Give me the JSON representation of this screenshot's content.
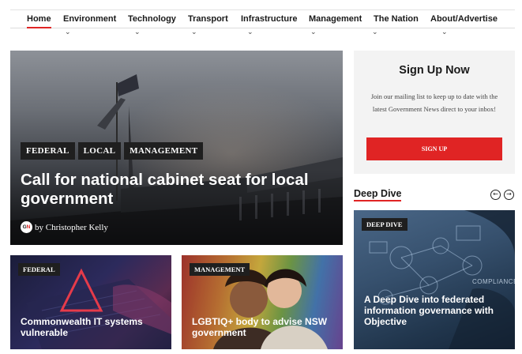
{
  "nav": {
    "items": [
      {
        "label": "Home",
        "active": true
      },
      {
        "label": "Environment"
      },
      {
        "label": "Technology"
      },
      {
        "label": "Transport"
      },
      {
        "label": "Infrastructure"
      },
      {
        "label": "Management"
      },
      {
        "label": "The Nation"
      },
      {
        "label": "About/Advertise"
      }
    ],
    "chevron_icon": "chevron-down-icon"
  },
  "hero": {
    "tags": [
      "FEDERAL",
      "LOCAL",
      "MANAGEMENT"
    ],
    "title": "Call for national cabinet seat for local government",
    "author_logo_text": "GN",
    "byline": "by Christopher Kelly"
  },
  "cards": [
    {
      "tag": "FEDERAL",
      "title": "Commonwealth IT systems vulnerable"
    },
    {
      "tag": "MANAGEMENT",
      "title": "LGBTIQ+ body to advise NSW government"
    }
  ],
  "signup": {
    "title": "Sign Up Now",
    "text": "Join our mailing list to keep up to date with the latest Government News direct to your inbox!",
    "button": "SIGN UP"
  },
  "deep_dive": {
    "heading": "Deep Dive",
    "prev_icon": "arrow-left-circle-icon",
    "next_icon": "arrow-right-circle-icon",
    "card": {
      "tag": "DEEP DIVE",
      "image_text": "COMPLIANCE",
      "title": "A Deep Dive into federated information governance with Objective"
    }
  },
  "colors": {
    "accent": "#e02424",
    "tag_bg": "#1f1f1f",
    "signup_bg": "#f3f3f3"
  }
}
